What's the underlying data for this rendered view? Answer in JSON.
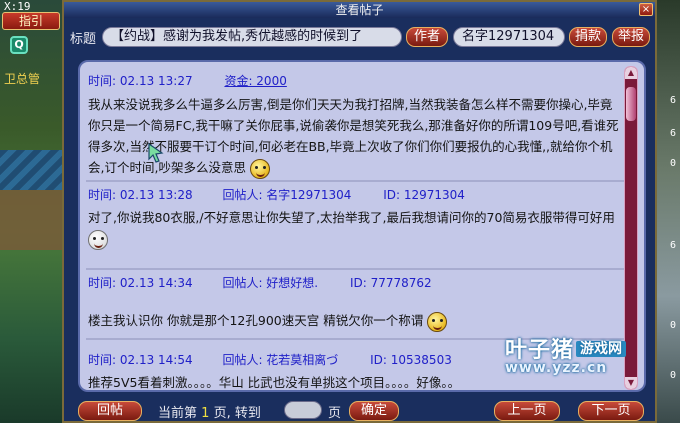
{
  "background": {
    "coords": "X:19",
    "guide_label": "指引",
    "badge": "Q",
    "npc_text": "卫总管",
    "right_digits": [
      "6",
      "6",
      "0",
      "6",
      "0",
      "0"
    ]
  },
  "window": {
    "title": "查看帖子",
    "close_label": "×"
  },
  "header": {
    "title_label": "标题",
    "title_value": "【约战】感谢为我发帖,秀优越感的时候到了",
    "author_button": "作者",
    "name_value": "名字12971304",
    "donate_button": "捐款",
    "report_button": "举报"
  },
  "posts": [
    {
      "meta_time": "时间: 02.13 13:27",
      "meta_funds": "资金: 2000",
      "body": "我从来没说我多么牛逼多么厉害,倒是你们天天为我打招牌,当然我装备怎么样不需要你操心,毕竟你只是一个简易FC,我干嘛了关你屁事,说偷袭你是想笑死我么,那淮备好你的所谓109号吧,看谁死得多次,当然不服要干订个时间,何必老在BB,毕竟上次收了你们你们要报仇的心我懂,,就给你个机会,订个时间,吵架多么没意思"
    },
    {
      "meta_time": "时间: 02.13 13:28",
      "meta_replier": "回帖人: 名字12971304",
      "meta_id": "ID: 12971304",
      "body": "对了,你说我80衣服,/不好意思让你失望了,太抬举我了,最后我想请问你的70简易衣服带得可好用"
    },
    {
      "meta_time": "时间: 02.13 14:34",
      "meta_replier": "回帖人: 好想好想.",
      "meta_id": "ID: 77778762",
      "body": "楼主我认识你 你就是那个12孔900速天宫 精锐欠你一个称谓"
    },
    {
      "meta_time": "时间: 02.13 14:54",
      "meta_replier": "回帖人: 花若莫相离づ",
      "meta_id": "ID: 10538503",
      "body": "推荐5V5看着刺激。。。。华山 比武也没有单挑这个项目。。。。好像。。"
    }
  ],
  "footer": {
    "reply_button": "回帖",
    "current_label": "当前第",
    "current_page": "1",
    "goto_label": "页, 转到",
    "page_suffix": "页",
    "confirm_button": "确定",
    "prev_button": "上一页",
    "next_button": "下一页"
  },
  "watermark": {
    "brand": "叶子猪",
    "tag": "游戏网",
    "url": "www.yzz.cn"
  },
  "colors": {
    "panel_bg": "#c4c8e8",
    "meta_blue": "#2020c8",
    "window_bg": "#1a2e5e",
    "button_red": "#c84a3a"
  }
}
